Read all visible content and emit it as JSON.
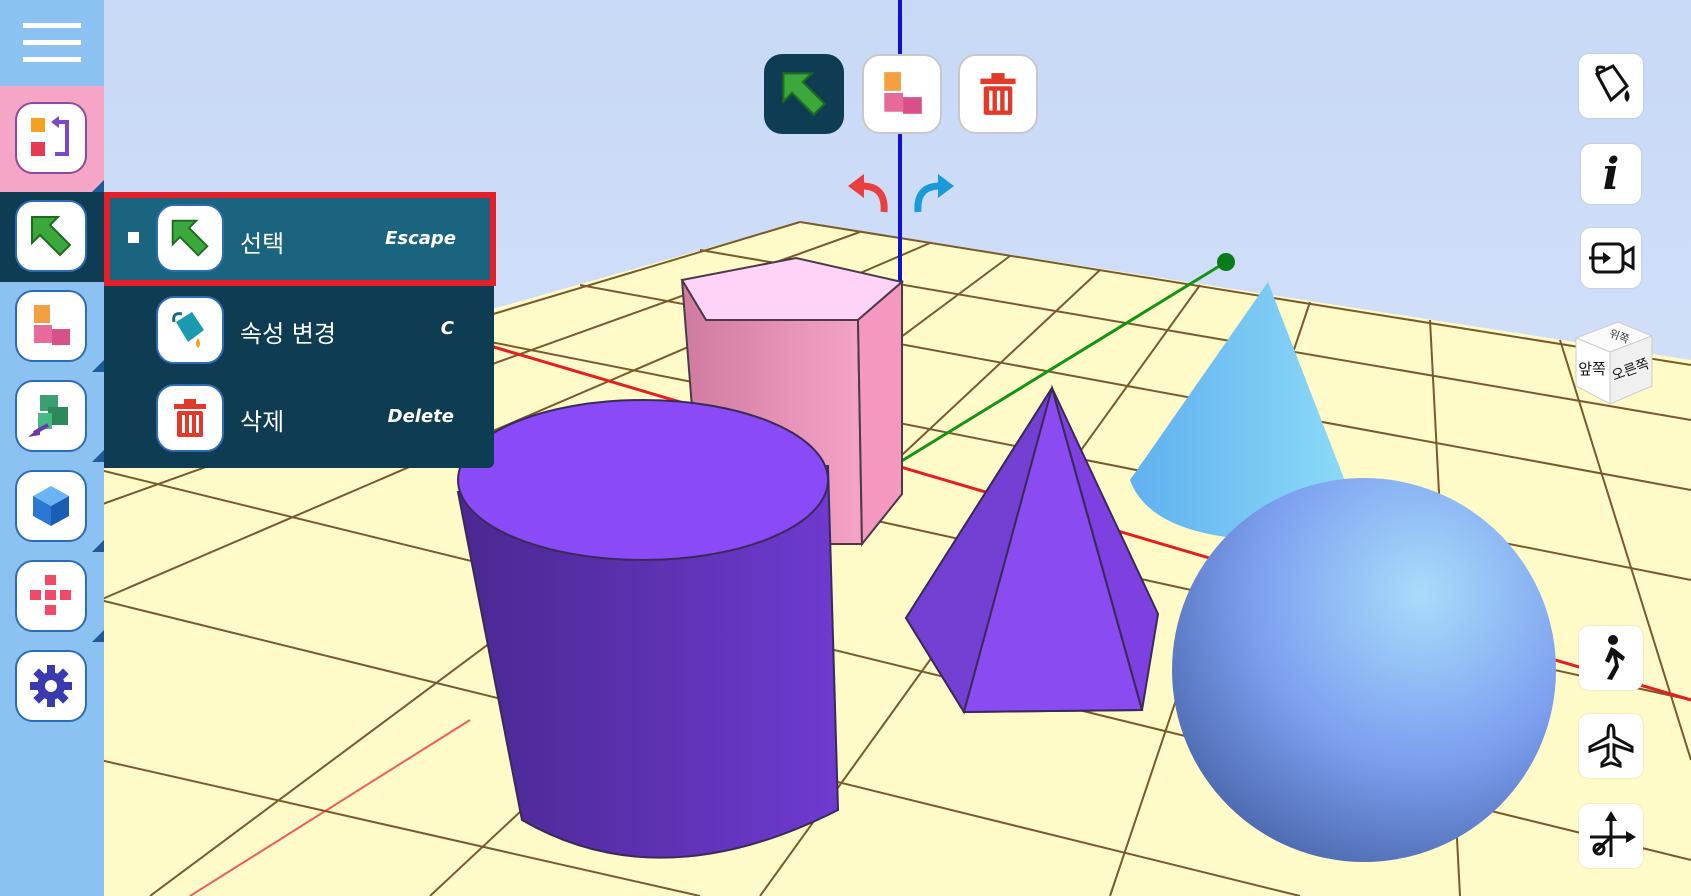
{
  "popup_menu": {
    "items": [
      {
        "label": "선택",
        "shortcut": "Escape",
        "selected": true,
        "icon": "select-arrow-icon"
      },
      {
        "label": "속성 변경",
        "shortcut": "C",
        "selected": false,
        "icon": "paint-bucket-icon"
      },
      {
        "label": "삭제",
        "shortcut": "Delete",
        "selected": false,
        "icon": "trash-icon"
      }
    ]
  },
  "view_cube": {
    "top": "위쪽",
    "front": "앞쪽",
    "right": "오른쪽"
  },
  "info_label": "i",
  "colors": {
    "sidebar_bg": "#8cc2f2",
    "popup_bg": "#0d3c53",
    "popup_selected": "#1a6480",
    "highlight_border": "#e3202a",
    "grid_floor": "#fffbc8"
  }
}
